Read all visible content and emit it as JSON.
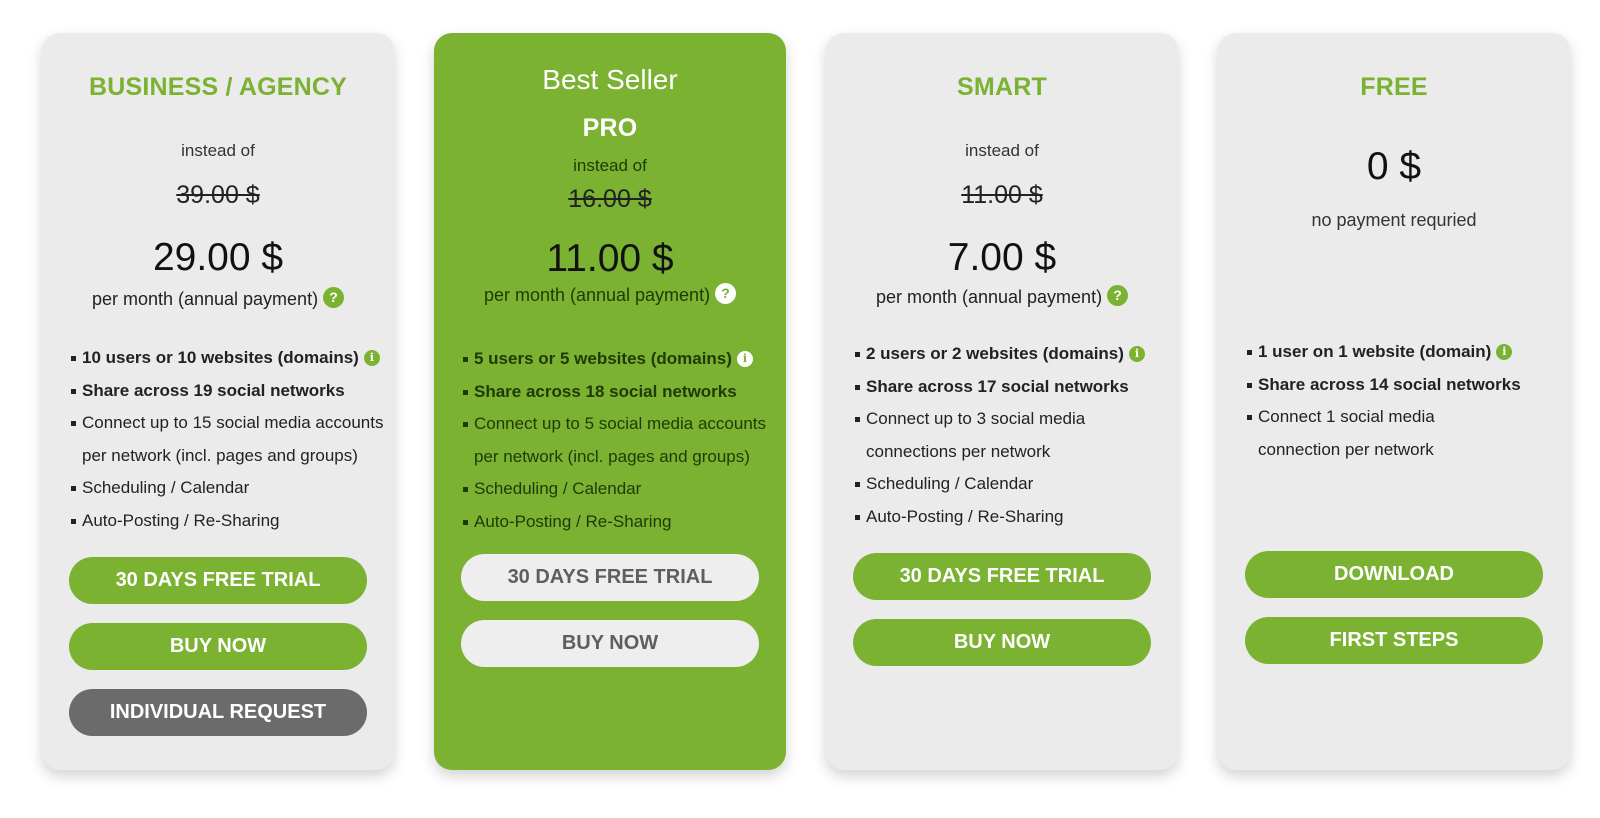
{
  "colors": {
    "accent": "#7bb231",
    "card_bg": "#ebebeb",
    "dark_button": "#6b6b6b"
  },
  "plans": [
    {
      "title": "BUSINESS / AGENCY",
      "instead_of": "instead of",
      "old_price": "39.00 $",
      "price": "29.00 $",
      "period": "per month (annual payment)",
      "features": [
        "10 users or 10 websites (domains)",
        "Share across 19 social networks",
        "Connect up to 15 social media accounts per network (incl. pages and groups)",
        "Scheduling / Calendar",
        "Auto-Posting / Re-Sharing"
      ],
      "buttons": [
        "30 DAYS FREE TRIAL",
        "BUY NOW",
        "INDIVIDUAL REQUEST"
      ]
    },
    {
      "badge": "Best Seller",
      "title": "PRO",
      "instead_of": "instead of",
      "old_price": "16.00 $",
      "price": "11.00 $",
      "period": "per month (annual payment)",
      "features": [
        "5 users or 5 websites (domains)",
        "Share across 18 social networks",
        "Connect up to 5 social media accounts per network (incl. pages and groups)",
        "Scheduling / Calendar",
        "Auto-Posting / Re-Sharing"
      ],
      "buttons": [
        "30 DAYS FREE TRIAL",
        "BUY NOW"
      ]
    },
    {
      "title": "SMART",
      "instead_of": "instead of",
      "old_price": "11.00 $",
      "price": "7.00 $",
      "period": "per month (annual payment)",
      "features": [
        "2 users or 2 websites (domains)",
        "Share across 17 social networks",
        "Connect up to 3 social media connections per network",
        "Scheduling / Calendar",
        "Auto-Posting / Re-Sharing"
      ],
      "buttons": [
        "30 DAYS FREE TRIAL",
        "BUY NOW"
      ]
    },
    {
      "title": "FREE",
      "price": "0 $",
      "subtext": "no payment requried",
      "features": [
        "1 user on 1 website (domain)",
        "Share across 14 social networks",
        "Connect 1 social media connection per network"
      ],
      "buttons": [
        "DOWNLOAD",
        "FIRST STEPS"
      ]
    }
  ],
  "icons": {
    "help": "question-circle-icon",
    "info": "info-circle-icon"
  }
}
